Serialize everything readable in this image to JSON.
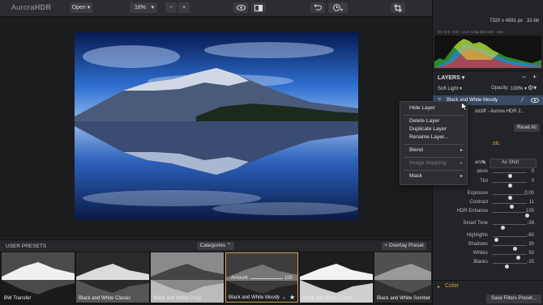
{
  "app": {
    "logo_prefix": "Aurora",
    "logo_suffix": "HDR"
  },
  "toolbar": {
    "open_label": "Open ▾",
    "zoom_value": "18%",
    "zoom_dropdown": "▾",
    "zoom_minus": "−",
    "zoom_plus": "+"
  },
  "status": {
    "dimensions": "7320 x 4891 px",
    "bit_depth": "32-bit",
    "exif": "EV  -2.0 - 0.0 - +2.0   3 img   ISO 100   -    -mm"
  },
  "layers": {
    "title": "LAYERS ▾",
    "minus": "−",
    "plus": "+",
    "blend_mode": "Soft Light ▾",
    "opacity_label": "Opacity:",
    "opacity_value": "100% ▾",
    "active_layer": "Black and White Moody",
    "base_layer": "otcliff - Aurora HDR 2..."
  },
  "context_menu": {
    "items": [
      {
        "label": "Hide Layer"
      },
      {
        "label": "Delete Layer"
      },
      {
        "label": "Duplicate Layer"
      },
      {
        "label": "Rename Layer..."
      },
      {
        "label": "Blend"
      },
      {
        "label": "Image Mapping"
      },
      {
        "label": "Mask"
      }
    ]
  },
  "panel": {
    "reset_all": "Reset All",
    "section_basic": "sic",
    "wb_label": "ance",
    "wb_value": "As Shot",
    "color_section": "Color",
    "save_preset": "Save Filters Preset..."
  },
  "sliders": [
    {
      "name": "ature",
      "value": "0",
      "level": 0.5
    },
    {
      "name": "Tint",
      "value": "0",
      "level": 0.5
    },
    {
      "name": "Exposure",
      "value": "0.00",
      "level": 0.5
    },
    {
      "name": "Contrast",
      "value": "11",
      "level": 0.56
    },
    {
      "name": "HDR Enhance",
      "value": "100",
      "level": 1.0
    },
    {
      "name": "Smart Tone",
      "value": "-39",
      "level": 0.3
    },
    {
      "name": "Highlights",
      "value": "-80",
      "level": 0.1
    },
    {
      "name": "Shadows",
      "value": "30",
      "level": 0.65
    },
    {
      "name": "Whites",
      "value": "50",
      "level": 0.75
    },
    {
      "name": "Blacks",
      "value": "-15",
      "level": 0.42
    }
  ],
  "presets": {
    "title": "USER PRESETS",
    "categories": "Categories ⌃",
    "overlay": "+ Overlay Preset",
    "amount_label": "Amount",
    "amount_value": "100",
    "thumbs": [
      {
        "label": "BW Transfer"
      },
      {
        "label": "Black and White Classic"
      },
      {
        "label": "Black and White Crisp"
      },
      {
        "label": "Black and White Moody"
      },
      {
        "label": "Black and White Punch"
      },
      {
        "label": "Black and White Somber"
      }
    ]
  },
  "colors": {
    "accent": "#d9a24a",
    "panel_bg": "#232427",
    "selected_row": "#3a4a63"
  }
}
